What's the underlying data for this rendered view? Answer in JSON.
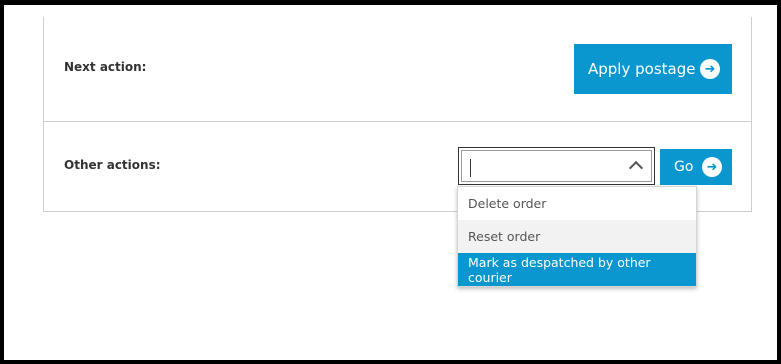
{
  "next_action": {
    "label": "Next action:",
    "button_label": "Apply postage",
    "button_icon": "arrow-right-circle-icon"
  },
  "other_actions": {
    "label": "Other actions:",
    "select_value": "",
    "go_label": "Go",
    "go_icon": "arrow-right-circle-icon",
    "options": [
      {
        "label": "Delete order",
        "state": "normal"
      },
      {
        "label": "Reset order",
        "state": "hover"
      },
      {
        "label": "Mark as despatched by other courier",
        "state": "selected"
      }
    ]
  },
  "colors": {
    "accent": "#0a97cf",
    "border": "#cfcfcf",
    "hover": "#f2f2f2"
  }
}
